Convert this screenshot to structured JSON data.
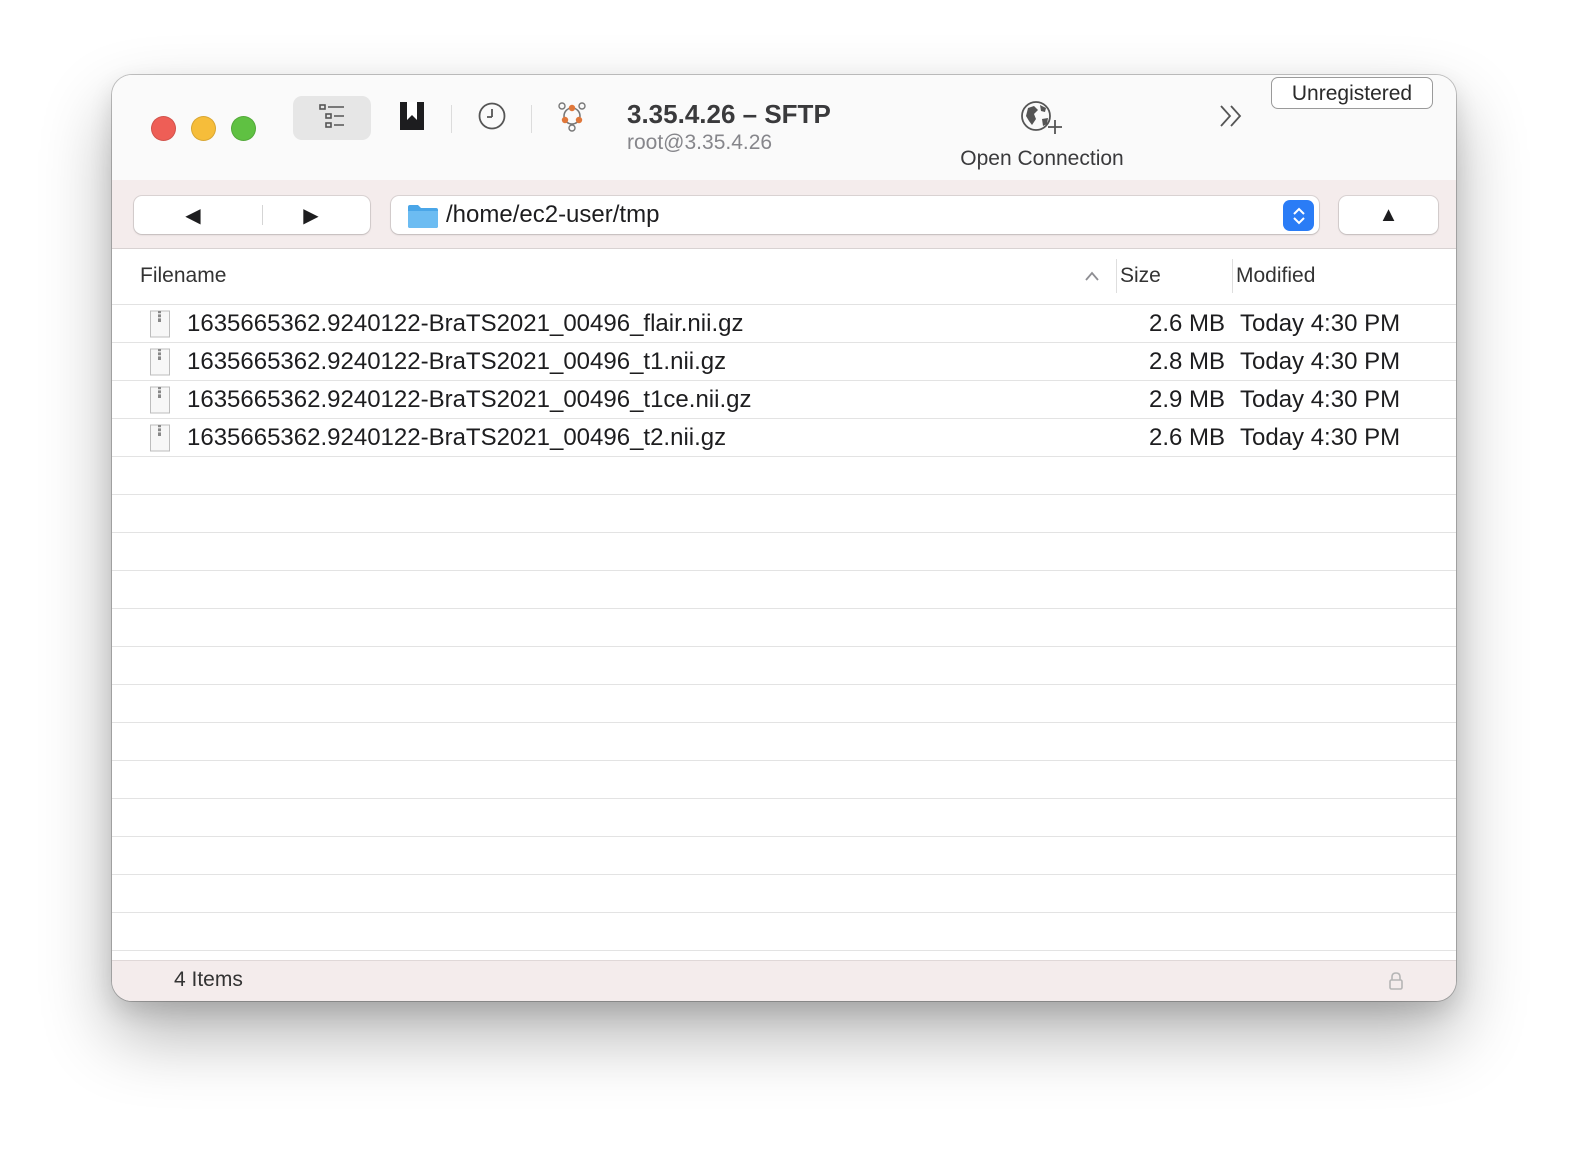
{
  "toolbar": {
    "connection_title": "3.35.4.26 – SFTP",
    "connection_subtitle": "root@3.35.4.26",
    "open_connection_label": "Open Connection",
    "unregistered_label": "Unregistered",
    "icons": {
      "outline": "outline-view-icon",
      "bookmark": "bookmark-icon",
      "history": "history-icon",
      "activity": "bonjour-icon",
      "open_connection": "globe-plus-icon",
      "more": "chevron-double-right-icon"
    }
  },
  "navigation": {
    "back_glyph": "◀",
    "forward_glyph": "▶",
    "up_glyph": "▲",
    "path": "/home/ec2-user/tmp"
  },
  "table": {
    "columns": {
      "filename": "Filename",
      "size": "Size",
      "modified": "Modified"
    },
    "sort_column": "Filename",
    "sort_direction": "ascending",
    "files": [
      {
        "name": "1635665362.9240122-BraTS2021_00496_flair.nii.gz",
        "size": "2.6 MB",
        "modified": "Today 4:30 PM"
      },
      {
        "name": "1635665362.9240122-BraTS2021_00496_t1.nii.gz",
        "size": "2.8 MB",
        "modified": "Today 4:30 PM"
      },
      {
        "name": "1635665362.9240122-BraTS2021_00496_t1ce.nii.gz",
        "size": "2.9 MB",
        "modified": "Today 4:30 PM"
      },
      {
        "name": "1635665362.9240122-BraTS2021_00496_t2.nii.gz",
        "size": "2.6 MB",
        "modified": "Today 4:30 PM"
      }
    ]
  },
  "status": {
    "item_count": "4 Items"
  },
  "colors": {
    "close": "#ee5e56",
    "minimize": "#f6bd3a",
    "maximize": "#5fc142",
    "accent": "#2a7cf6",
    "bar_tint": "#f4ecec"
  }
}
